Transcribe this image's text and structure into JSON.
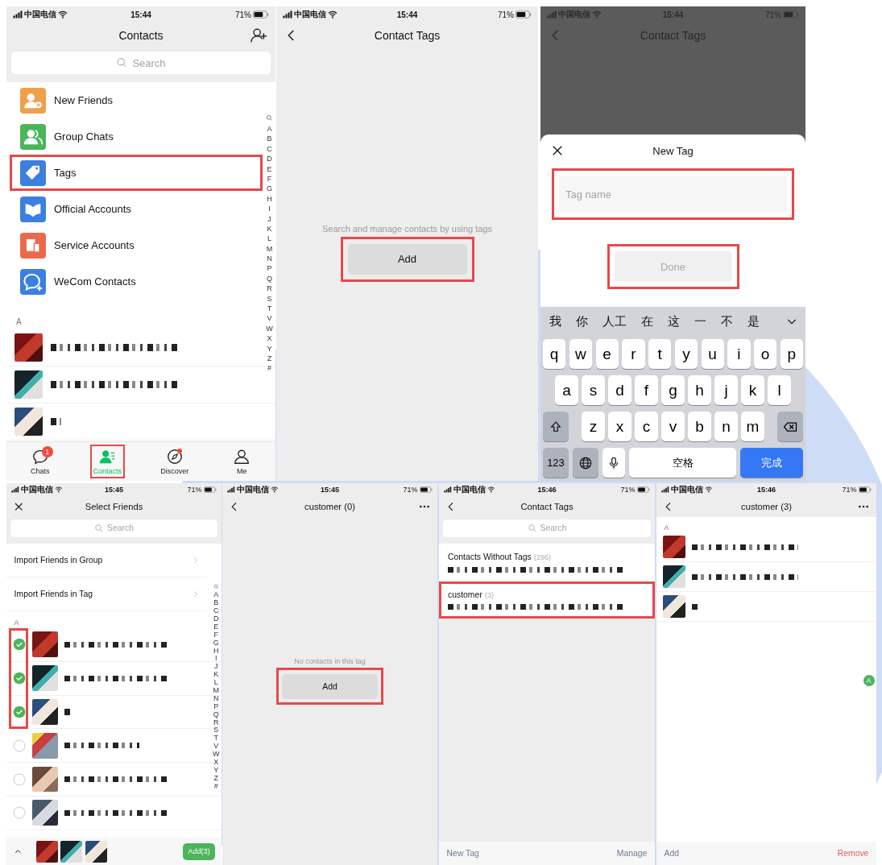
{
  "screens": [
    {
      "kind": "contacts",
      "status": {
        "carrier": "中国电信",
        "time": "15:44",
        "battery": "71%"
      },
      "title": "Contacts",
      "search": {
        "placeholder": "Search"
      },
      "entries": [
        {
          "label": "New Friends",
          "color": "#f0a04a",
          "highlighted": false
        },
        {
          "label": "Group Chats",
          "color": "#4cb45a",
          "highlighted": false
        },
        {
          "label": "Tags",
          "color": "#3d7fe0",
          "highlighted": true
        },
        {
          "label": "Official Accounts",
          "color": "#3d7fe0",
          "highlighted": false
        },
        {
          "label": "Service Accounts",
          "color": "#ec6a4c",
          "highlighted": false
        },
        {
          "label": "WeCom Contacts",
          "color": "#3d7fe0",
          "highlighted": false
        }
      ],
      "section": "A",
      "contacts": [
        {
          "kind": "blurred"
        },
        {
          "kind": "blurred"
        },
        {
          "kind": "blurred"
        }
      ],
      "index": [
        "A",
        "B",
        "C",
        "D",
        "E",
        "F",
        "G",
        "H",
        "I",
        "J",
        "K",
        "L",
        "M",
        "N",
        "P",
        "Q",
        "R",
        "S",
        "T",
        "V",
        "W",
        "X",
        "Y",
        "Z",
        "#"
      ],
      "tabs": [
        {
          "label": "Chats",
          "selected": false,
          "badge": "1",
          "dot": false,
          "highlighted": false
        },
        {
          "label": "Contacts",
          "selected": true,
          "dot": false,
          "highlighted": true
        },
        {
          "label": "Discover",
          "selected": false,
          "dot": true,
          "highlighted": false
        },
        {
          "label": "Me",
          "selected": false,
          "dot": false,
          "highlighted": false
        }
      ]
    },
    {
      "kind": "empty-tag-list",
      "status": {
        "carrier": "中国电信",
        "time": "15:44",
        "battery": "71%"
      },
      "title": "Contact Tags",
      "hint": "Search and manage contacts by using tags",
      "button": {
        "label": "Add",
        "highlighted": true
      }
    },
    {
      "kind": "new-tag",
      "status": {
        "carrier": "中国电信",
        "time": "15:44",
        "battery": "71%"
      },
      "title": "Contact Tags",
      "sheet": {
        "title": "New Tag",
        "field": {
          "placeholder": "Tag name",
          "highlighted": true
        },
        "button": {
          "label": "Done",
          "disabled": true,
          "highlighted": true
        }
      },
      "keyboard": {
        "candidates": [
          "我",
          "你",
          "人工",
          "在",
          "这",
          "一",
          "不",
          "是"
        ],
        "rows": [
          [
            "q",
            "w",
            "e",
            "r",
            "t",
            "y",
            "u",
            "i",
            "o",
            "p"
          ],
          [
            "a",
            "s",
            "d",
            "f",
            "g",
            "h",
            "j",
            "k",
            "l"
          ],
          [
            "z",
            "x",
            "c",
            "v",
            "b",
            "n",
            "m"
          ]
        ],
        "bottom_keys": [
          {
            "kind": "mode",
            "label": "123"
          },
          {
            "kind": "globe"
          },
          {
            "kind": "mic"
          },
          {
            "kind": "space",
            "label": "空格"
          },
          {
            "kind": "return",
            "label": "完成"
          }
        ]
      }
    },
    {
      "kind": "select-friends",
      "status": {
        "carrier": "中国电信",
        "time": "15:45",
        "battery": "71%"
      },
      "title": "Select Friends",
      "search": {
        "placeholder": "Search"
      },
      "links": [
        {
          "label": "Import Friends in Group"
        },
        {
          "label": "Import Friends in Tag"
        }
      ],
      "section": "A",
      "contacts": [
        {
          "kind": "blurred",
          "checked": true,
          "highlighted": true
        },
        {
          "kind": "blurred",
          "checked": true,
          "highlighted": true
        },
        {
          "kind": "blurred",
          "checked": true,
          "highlighted": true
        },
        {
          "kind": "blurred",
          "checked": false,
          "highlighted": false
        },
        {
          "kind": "blurred",
          "checked": false,
          "highlighted": false
        },
        {
          "kind": "blurred",
          "checked": false,
          "highlighted": false
        }
      ],
      "index": [
        "A",
        "B",
        "C",
        "D",
        "E",
        "F",
        "G",
        "H",
        "I",
        "J",
        "K",
        "L",
        "M",
        "N",
        "P",
        "Q",
        "R",
        "S",
        "T",
        "V",
        "W",
        "X",
        "Y",
        "Z",
        "#"
      ],
      "footer": {
        "button": "Add(3)"
      }
    },
    {
      "kind": "empty-tag",
      "status": {
        "carrier": "中国电信",
        "time": "15:45",
        "battery": "71%"
      },
      "title": "customer (0)",
      "hint": "No contacts in this tag",
      "button": {
        "label": "Add",
        "highlighted": true
      }
    },
    {
      "kind": "tag-list",
      "status": {
        "carrier": "中国电信",
        "time": "15:46",
        "battery": "71%"
      },
      "title": "Contact Tags",
      "search": {
        "placeholder": "Search"
      },
      "tags": [
        {
          "name": "Contacts Without Tags",
          "count": "(296)",
          "highlighted": false
        },
        {
          "name": "customer",
          "count": "(3)",
          "highlighted": true
        }
      ],
      "footer": {
        "left": "New Tag",
        "right": "Manage"
      }
    },
    {
      "kind": "tag-members",
      "status": {
        "carrier": "中国电信",
        "time": "15:46",
        "battery": "71%"
      },
      "title": "customer (3)",
      "section": "A",
      "contacts": [
        {
          "kind": "blurred"
        },
        {
          "kind": "blurred"
        },
        {
          "kind": "blurred"
        }
      ],
      "index_badge": "A",
      "footer": {
        "left": "Add",
        "right": "Remove"
      }
    }
  ]
}
